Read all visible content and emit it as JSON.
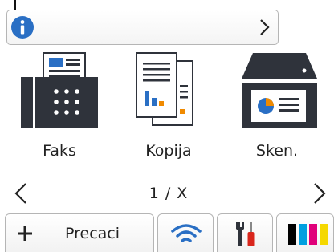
{
  "info_bar": {
    "icon": "info-icon"
  },
  "tiles": [
    {
      "label": "Faks",
      "icon": "fax-icon"
    },
    {
      "label": "Kopija",
      "icon": "copy-icon"
    },
    {
      "label": "Sken.",
      "icon": "scan-icon"
    }
  ],
  "pager": {
    "text": "1 / X"
  },
  "bottom_bar": {
    "shortcuts_label": "Precaci",
    "wifi_icon": "wifi-icon",
    "tools_icon": "tools-icon",
    "ink_icon": "ink-icon",
    "ink_colors": [
      "#000000",
      "#00a0e0",
      "#e0007a",
      "#f5d800"
    ]
  },
  "colors": {
    "accent": "#2a6fc4",
    "dark": "#2f333b"
  }
}
